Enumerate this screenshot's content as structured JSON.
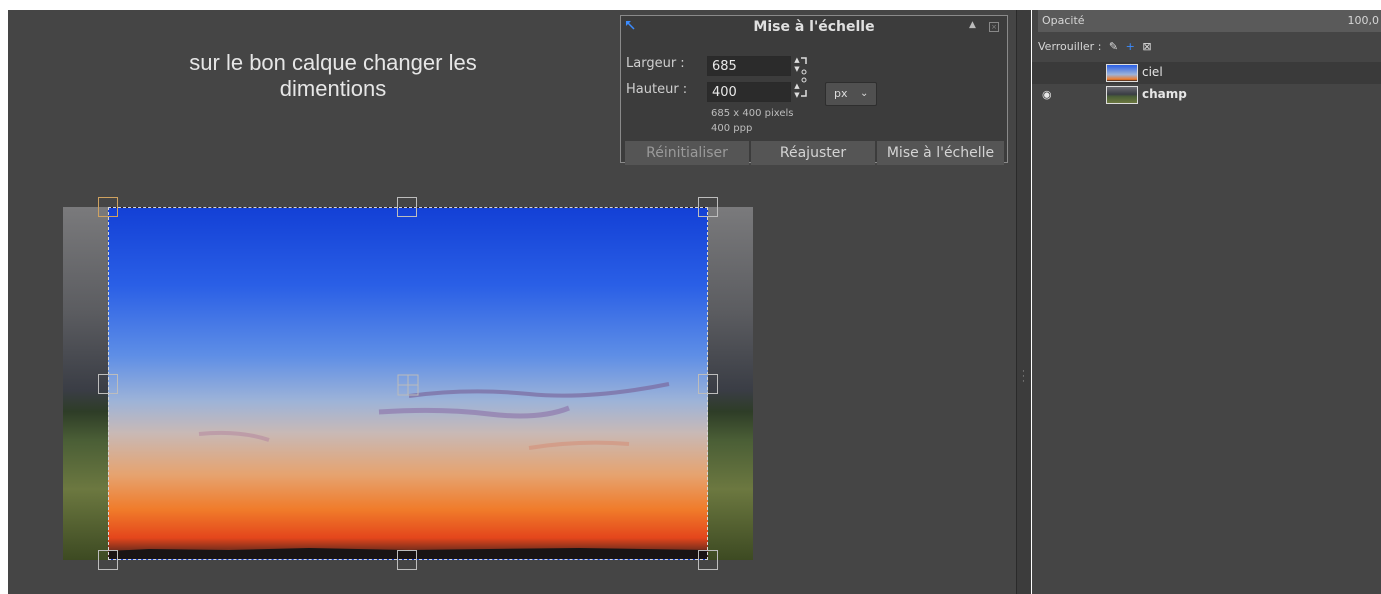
{
  "instruction": {
    "line1": "sur le bon calque changer les",
    "line2": "dimentions"
  },
  "scale_dialog": {
    "title": "Mise à l'échelle",
    "width_label": "Largeur :",
    "width_value": "685",
    "height_label": "Hauteur :",
    "height_value": "400",
    "unit": "px",
    "size_info": "685 x 400 pixels",
    "resolution_info": "400 ppp",
    "buttons": {
      "reset": "Réinitialiser",
      "readjust": "Réajuster",
      "scale": "Mise à l'échelle"
    },
    "icons": [
      "move-icon",
      "chain-link-icon",
      "chevron-down-icon",
      "close-icon",
      "up-arrow-icon"
    ]
  },
  "layers_panel": {
    "opacity_label": "Opacité",
    "opacity_value": "100,0",
    "lock_label": "Verrouiller :",
    "layers": [
      {
        "name": "ciel",
        "visible": false,
        "selected": true
      },
      {
        "name": "champ",
        "visible": true,
        "selected": false
      }
    ]
  },
  "colors": {
    "canvas_bg": "#454545",
    "dialog_bg": "#3c3c3c",
    "accent": "#2a7fff"
  }
}
